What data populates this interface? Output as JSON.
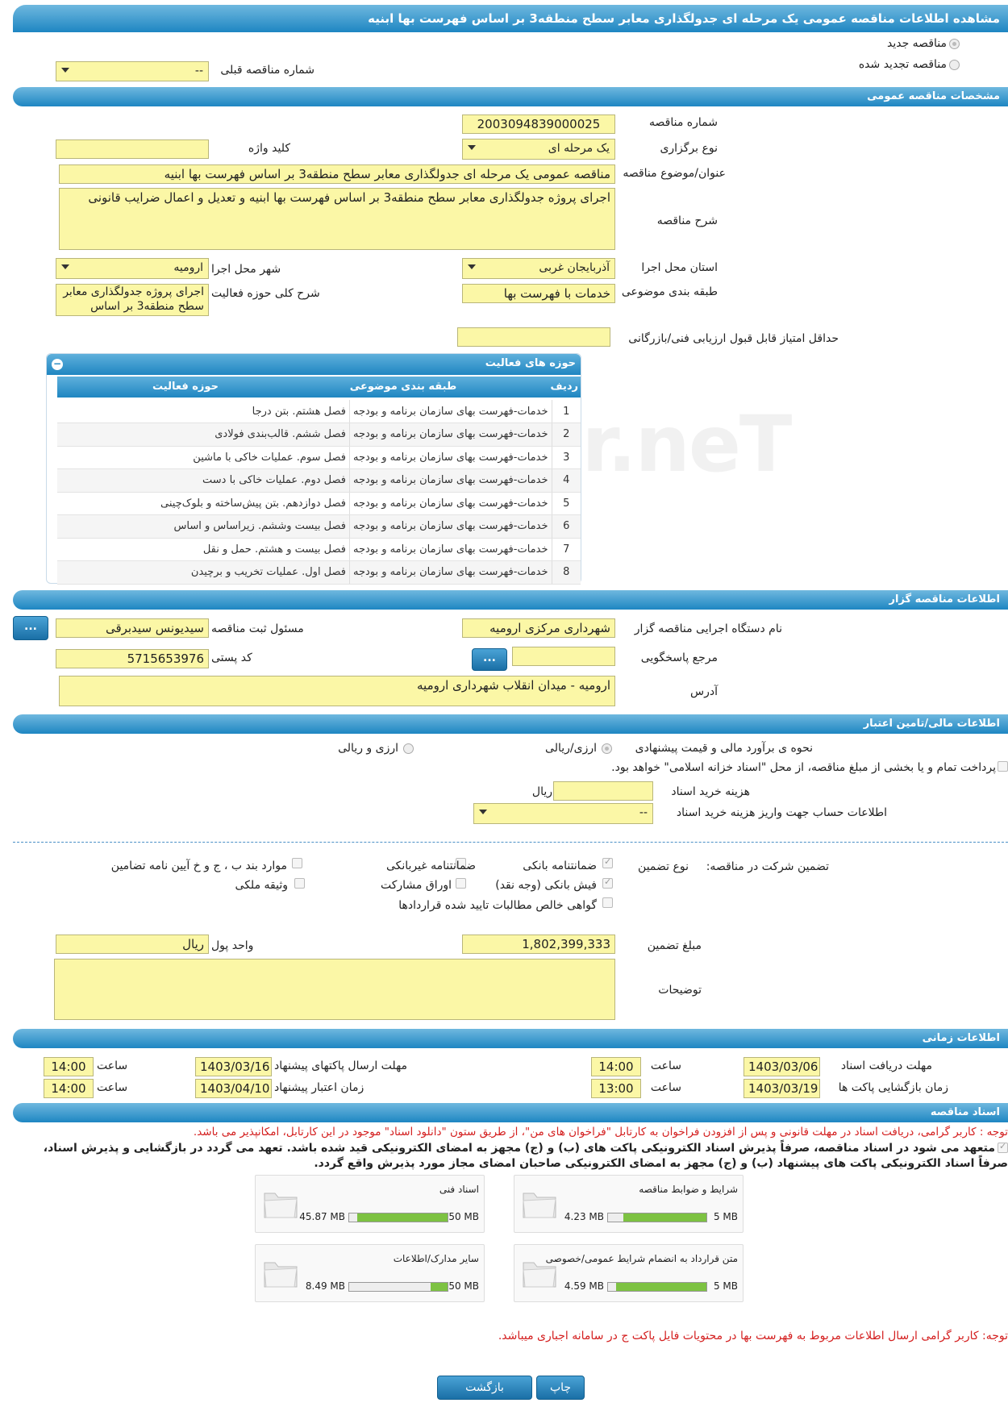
{
  "header": {
    "title": "مشاهده اطلاعات مناقصه عمومی یک مرحله ای جدولگذاری معابر سطح منطقه3 بر اساس فهرست بها ابنیه"
  },
  "top": {
    "new_tender": "مناقصه جدید",
    "renewed_tender": "مناقصه تجدید شده",
    "prev_number_label": "شماره مناقصه قبلی",
    "prev_number_value": "--"
  },
  "general": {
    "section_title": "مشخصات مناقصه عمومی",
    "number_label": "شماره مناقصه",
    "number_value": "2003094839000025",
    "keyword_label": "کلید واژه",
    "keyword_value": "",
    "type_label": "نوع برگزاری",
    "type_value": "یک مرحله ای",
    "subject_label": "عنوان/موضوع مناقصه",
    "subject_value": "مناقصه عمومی یک مرحله ای جدولگذاری معابر سطح منطقه3 بر اساس فهرست بها ابنیه",
    "desc_label": "شرح مناقصه",
    "desc_value": "اجرای پروژه جدولگذاری معابر سطح منطقه3 بر اساس فهرست بها ابنیه و تعدیل و اعمال ضرایب قانونی",
    "province_label": "استان محل اجرا",
    "province_value": "آذربایجان غربی",
    "city_label": "شهر محل اجرا",
    "city_value": "ارومیه",
    "category_label": "طبقه بندی موضوعی",
    "category_value": "خدمات با فهرست بها",
    "scope_label": "شرح کلی حوزه فعالیت",
    "scope_value_1": "اجرای پروژه جدولگذاری معابر",
    "scope_value_2": "سطح منطقه3 بر اساس",
    "min_score_label": "حداقل امتیاز قابل قبول ارزیابی فنی/بازرگانی",
    "min_score_value": ""
  },
  "activities": {
    "title": "حوزه های فعالیت",
    "col_row": "ردیف",
    "col_category": "طبقه بندی موضوعی",
    "col_activity": "حوزه فعالیت",
    "rows": [
      {
        "n": "1",
        "cat": "خدمات-فهرست بهای سازمان برنامه و بودجه",
        "act": "فصل هشتم. بتن درجا"
      },
      {
        "n": "2",
        "cat": "خدمات-فهرست بهای سازمان برنامه و بودجه",
        "act": "فصل ششم. قالب‌بندی فولادی"
      },
      {
        "n": "3",
        "cat": "خدمات-فهرست بهای سازمان برنامه و بودجه",
        "act": "فصل سوم. عملیات خاکی با ماشین"
      },
      {
        "n": "4",
        "cat": "خدمات-فهرست بهای سازمان برنامه و بودجه",
        "act": "فصل دوم. عملیات خاکی با دست"
      },
      {
        "n": "5",
        "cat": "خدمات-فهرست بهای سازمان برنامه و بودجه",
        "act": "فصل دوازدهم. بتن پیش‌ساخته و بلوک‌چینی"
      },
      {
        "n": "6",
        "cat": "خدمات-فهرست بهای سازمان برنامه و بودجه",
        "act": "فصل بیست وششم. زیراساس و اساس"
      },
      {
        "n": "7",
        "cat": "خدمات-فهرست بهای سازمان برنامه و بودجه",
        "act": "فصل بیست و هشتم. حمل و نقل"
      },
      {
        "n": "8",
        "cat": "خدمات-فهرست بهای سازمان برنامه و بودجه",
        "act": "فصل اول. عملیات تخریب و برچیدن"
      }
    ]
  },
  "organizer": {
    "section_title": "اطلاعات مناقصه گزار",
    "org_label": "نام دستگاه اجرایی مناقصه گزار",
    "org_value": "شهرداری مرکزی ارومیه",
    "resp_label": "مسئول ثبت مناقصه",
    "resp_value": "سیدیونس سیدبرقی",
    "ref_label": "مرجع پاسخگویی",
    "ref_value": "",
    "postal_label": "کد پستی",
    "postal_value": "5715653976",
    "address_label": "آدرس",
    "address_value": "ارومیه - میدان انقلاب شهرداری ارومیه",
    "dots": "..."
  },
  "finance": {
    "section_title": "اطلاعات مالی/تامین اعتبار",
    "method_label": "نحوه ی برآورد مالی و قیمت پیشنهادی",
    "opt1": "ارزی/ریالی",
    "opt2": "ارزی و ریالی",
    "treasury_text": "پرداخت تمام و یا بخشی از مبلغ مناقصه، از محل \"اسناد خزانه اسلامی\" خواهد بود.",
    "doc_cost_label": "هزینه خرید اسناد",
    "doc_cost_unit": "ریال",
    "doc_cost_value": "",
    "account_label": "اطلاعات حساب جهت واریز هزینه خرید اسناد",
    "account_value": "--"
  },
  "guarantee": {
    "participation_label": "تضمین شرکت در مناقصه:",
    "type_label": "نوع تضمین",
    "bank_guarantee": "ضمانتنامه بانکی",
    "non_bank": "ضمانتنامه غیربانکی",
    "bylaw": "موارد بند ب ، ج و خ آیین نامه تضامین",
    "bank_receipt": "فیش بانکی (وجه نقد)",
    "bonds": "اوراق مشارکت",
    "property": "وثیقه ملکی",
    "claims": "گواهی خالص مطالبات تایید شده قراردادها",
    "amount_label": "مبلغ تضمین",
    "amount_value": "1,802,399,333",
    "currency_label": "واحد پول",
    "currency_value": "ریال",
    "notes_label": "توضیحات",
    "notes_value": ""
  },
  "timing": {
    "section_title": "اطلاعات زمانی",
    "doc_deadline_label": "مهلت دریافت اسناد",
    "doc_deadline_date": "1403/03/06",
    "time_label": "ساعت",
    "doc_deadline_time": "14:00",
    "send_deadline_label": "مهلت ارسال پاکتهای پیشنهاد",
    "send_deadline_date": "1403/03/16",
    "send_deadline_time": "14:00",
    "opening_label": "زمان بازگشایی پاکت ها",
    "opening_date": "1403/03/19",
    "opening_time": "13:00",
    "validity_label": "زمان اعتبار پیشنهاد",
    "validity_date": "1403/04/10",
    "validity_time": "14:00"
  },
  "documents": {
    "section_title": "اسناد مناقصه",
    "note1": "توجه : کاربر گرامی، دریافت اسناد در مهلت قانونی و پس از افزودن فراخوان به کارتابل \"فراخوان های من\"، از طریق ستون \"دانلود اسناد\" موجود در این کارتابل، امکانپذیر می باشد.",
    "commit1": "متعهد می شود در اسناد مناقصه، صرفاً پذیرش اسناد الکترونیکی پاکت های (ب) و (ج) مجهز به امضای الکترونیکی قید شده باشد. تعهد می گردد در بازگشایی و پذیرش اسناد،",
    "commit2": "صرفاً اسناد الکترونیکی پاکت های پیشنهاد (ب) و (ج) مجهز به امضای الکترونیکی صاحبان امضای مجاز مورد پذیرش واقع گردد.",
    "files": [
      {
        "name": "شرایط و ضوابط مناقصه",
        "size": "4.23 MB",
        "max": "5 MB",
        "ratio": 0.846
      },
      {
        "name": "اسناد فنی",
        "size": "45.87 MB",
        "max": "50 MB",
        "ratio": 0.917
      },
      {
        "name": "متن قرارداد به انضمام شرایط عمومی/خصوصی",
        "size": "4.59 MB",
        "max": "5 MB",
        "ratio": 0.918
      },
      {
        "name": "سایر مدارک/اطلاعات",
        "size": "8.49 MB",
        "max": "50 MB",
        "ratio": 0.17
      }
    ],
    "note2": "توجه: کاربر گرامی ارسال اطلاعات مربوط به فهرست بها در محتویات فایل پاکت ج در سامانه اجباری میباشد."
  },
  "footer": {
    "print": "چاپ",
    "back": "بازگشت"
  },
  "colors": {
    "accent": "#1e86c2",
    "field": "#fbf7a6",
    "progress": "#7dc242",
    "warning": "#d42020"
  }
}
